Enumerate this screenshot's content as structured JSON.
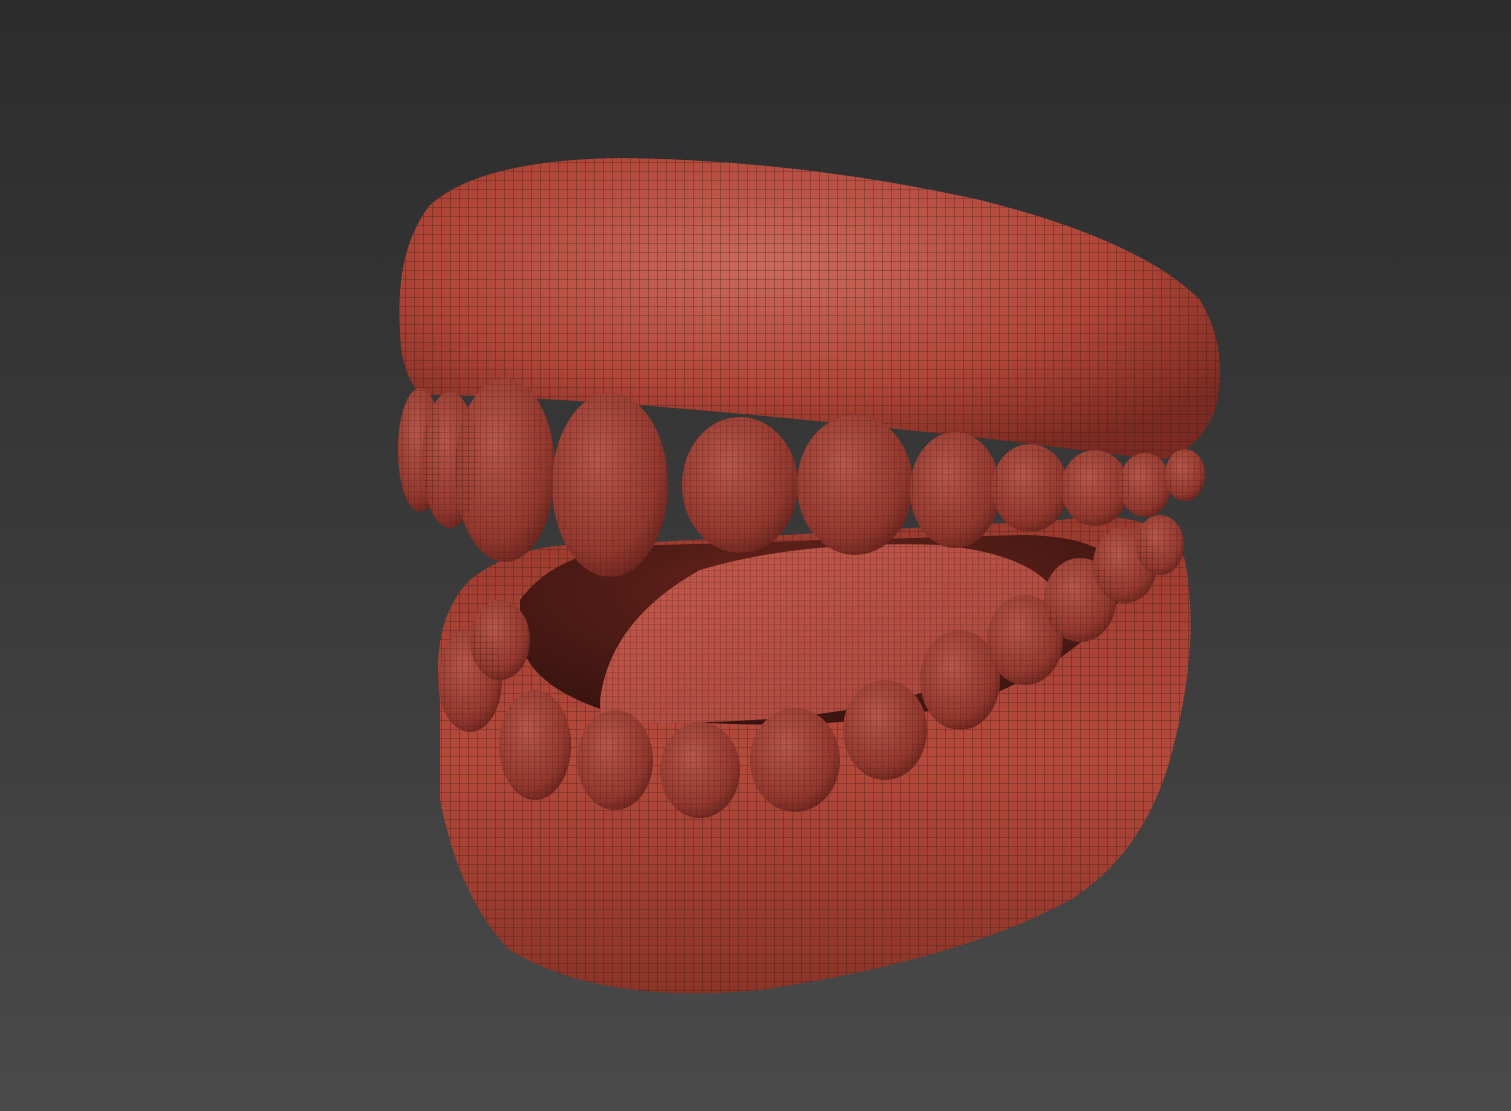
{
  "viewport": {
    "background_top": "#2c2c2c",
    "background_bottom": "#4a4a4a"
  },
  "model": {
    "subject": "dentures-wireframe-icon",
    "mesh_color": "#b84a3c",
    "mesh_highlight": "#d4786a",
    "mesh_shadow": "#6e2620",
    "wire_color": "#3a1410"
  }
}
